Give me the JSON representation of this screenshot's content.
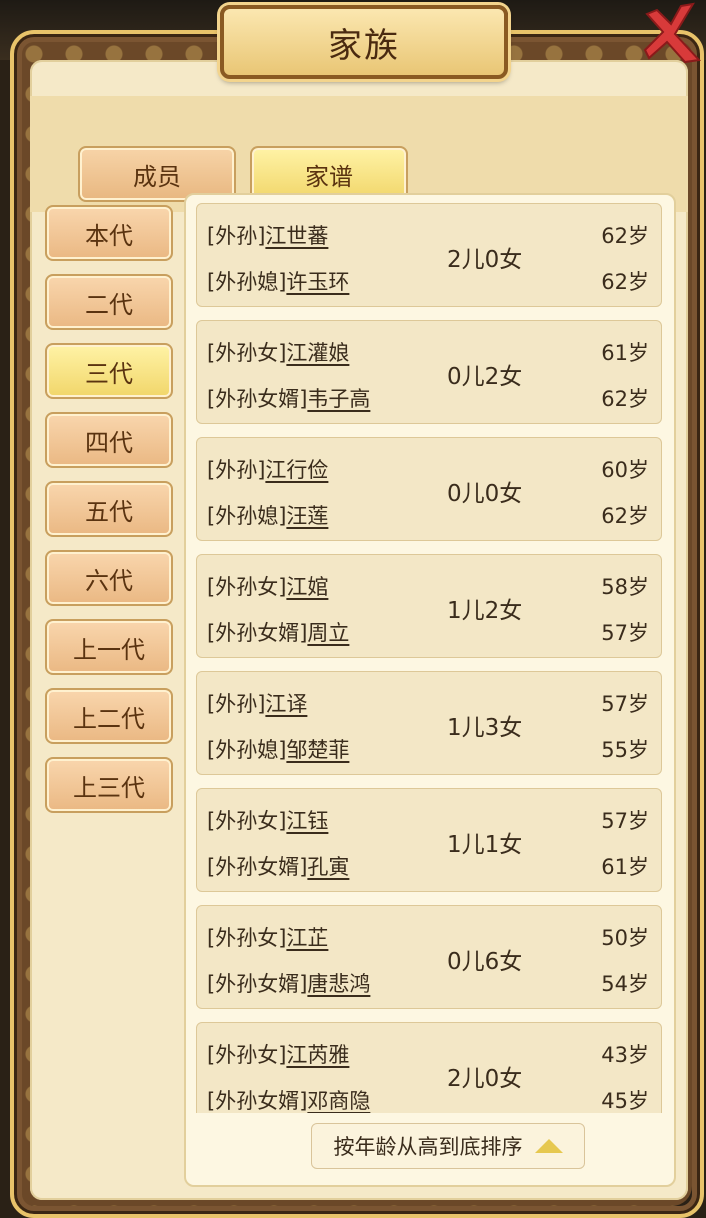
{
  "title": "家族",
  "tabs": [
    {
      "label": "成员",
      "active": false
    },
    {
      "label": "家谱",
      "active": true
    }
  ],
  "generations": [
    {
      "label": "本代",
      "active": false
    },
    {
      "label": "二代",
      "active": false
    },
    {
      "label": "三代",
      "active": true
    },
    {
      "label": "四代",
      "active": false
    },
    {
      "label": "五代",
      "active": false
    },
    {
      "label": "六代",
      "active": false
    },
    {
      "label": "上一代",
      "active": false
    },
    {
      "label": "上二代",
      "active": false
    },
    {
      "label": "上三代",
      "active": false
    }
  ],
  "entries": [
    {
      "rel1": "[外孙]",
      "name1": "江世蕃",
      "age1": "62岁",
      "rel2": "[外孙媳]",
      "name2": "许玉环",
      "age2": "62岁",
      "children": "2儿0女"
    },
    {
      "rel1": "[外孙女]",
      "name1": "江灌娘",
      "age1": "61岁",
      "rel2": "[外孙女婿]",
      "name2": "韦子高",
      "age2": "62岁",
      "children": "0儿2女"
    },
    {
      "rel1": "[外孙]",
      "name1": "江行俭",
      "age1": "60岁",
      "rel2": "[外孙媳]",
      "name2": "汪莲",
      "age2": "62岁",
      "children": "0儿0女"
    },
    {
      "rel1": "[外孙女]",
      "name1": "江婠",
      "age1": "58岁",
      "rel2": "[外孙女婿]",
      "name2": "周立",
      "age2": "57岁",
      "children": "1儿2女"
    },
    {
      "rel1": "[外孙]",
      "name1": "江译",
      "age1": "57岁",
      "rel2": "[外孙媳]",
      "name2": "邹楚菲",
      "age2": "55岁",
      "children": "1儿3女"
    },
    {
      "rel1": "[外孙女]",
      "name1": "江钰",
      "age1": "57岁",
      "rel2": "[外孙女婿]",
      "name2": "孔寅",
      "age2": "61岁",
      "children": "1儿1女"
    },
    {
      "rel1": "[外孙女]",
      "name1": "江芷",
      "age1": "50岁",
      "rel2": "[外孙女婿]",
      "name2": "唐悲鸿",
      "age2": "54岁",
      "children": "0儿6女"
    },
    {
      "rel1": "[外孙女]",
      "name1": "江芮雅",
      "age1": "43岁",
      "rel2": "[外孙女婿]",
      "name2": "邓商隐",
      "age2": "45岁",
      "children": "2儿0女"
    }
  ],
  "sort_button": {
    "label": "按年龄从高到底排序",
    "icon": "triangle-up-icon"
  },
  "close_icon": "close-x-icon",
  "colors": {
    "accent_gold": "#f1d66a",
    "panel": "#f5e9c8",
    "frame": "#6b4828",
    "close_red": "#d83a3a"
  }
}
